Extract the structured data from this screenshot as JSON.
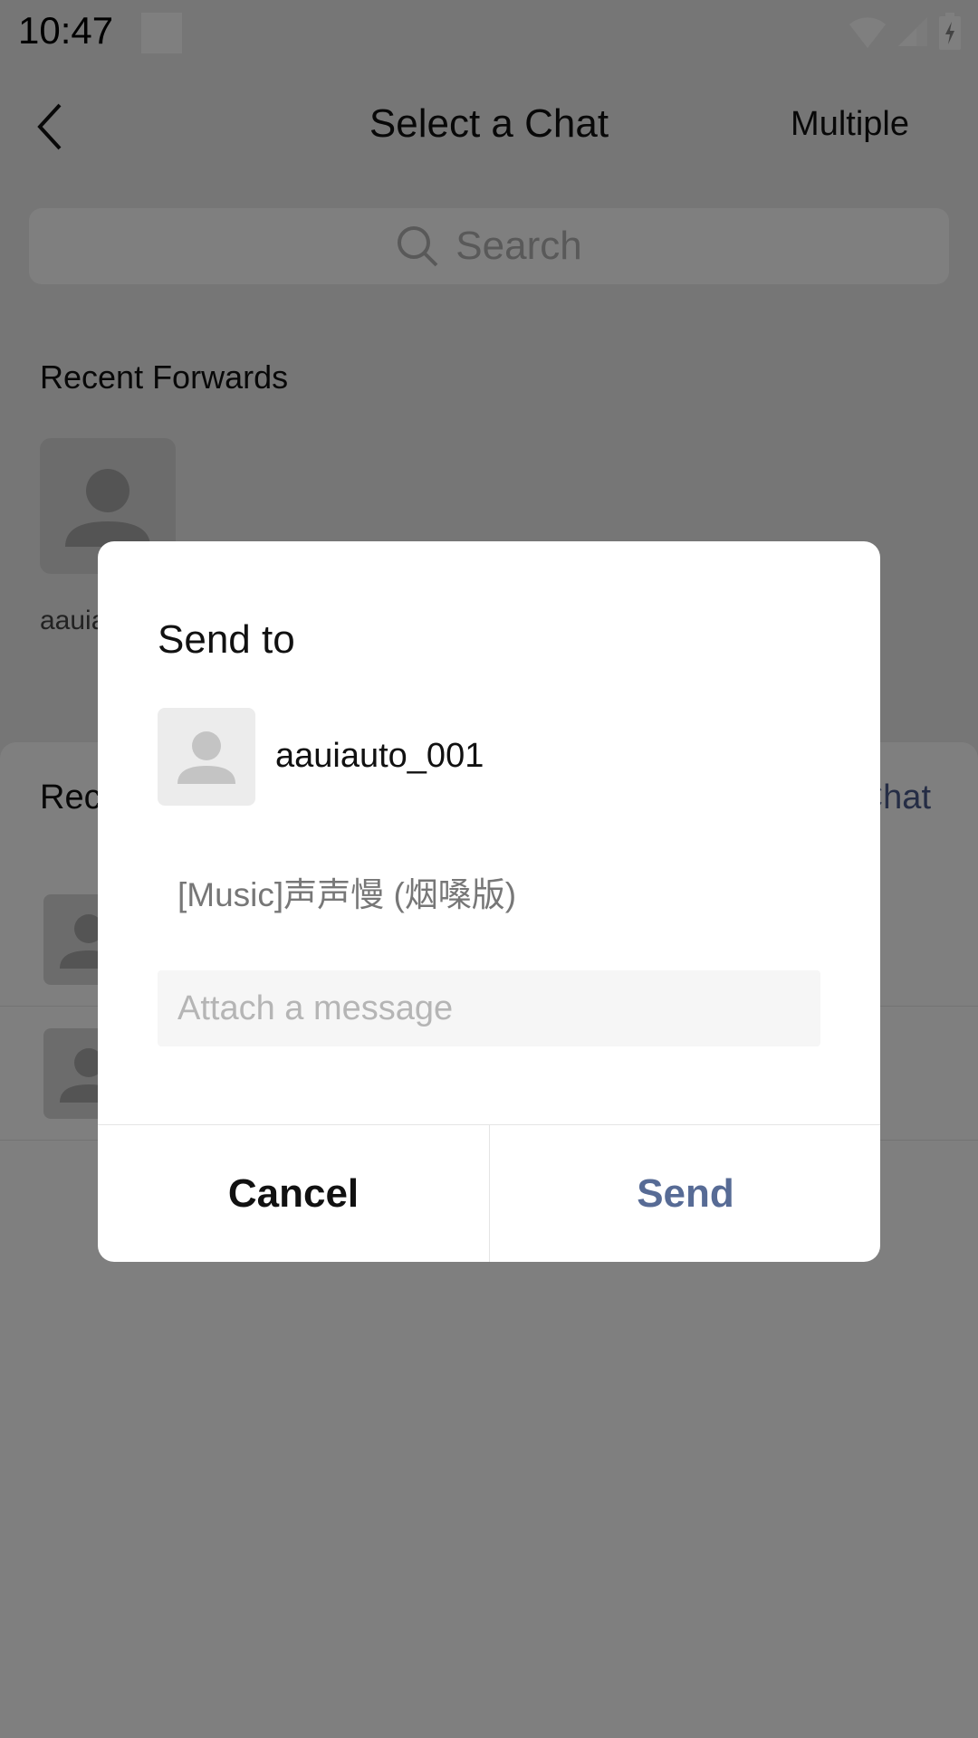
{
  "status_bar": {
    "time": "10:47"
  },
  "header": {
    "title": "Select a Chat",
    "multiple_label": "Multiple"
  },
  "search": {
    "placeholder": "Search"
  },
  "recent_forwards": {
    "title": "Recent Forwards",
    "items": [
      {
        "name": "aauiauto_001"
      }
    ]
  },
  "recent_chats": {
    "title": "Recent Chats",
    "new_chat_label": "New Chat"
  },
  "dialog": {
    "title": "Send to",
    "recipient_name": "aauiauto_001",
    "shared_item": "[Music]声声慢 (烟嗓版)",
    "message_placeholder": "Attach a message",
    "cancel_label": "Cancel",
    "send_label": "Send"
  },
  "colors": {
    "accent": "#576b95",
    "overlay": "rgba(0,0,0,0.5)"
  },
  "icons": [
    "back-arrow-icon",
    "search-icon",
    "default-avatar-icon",
    "wifi-icon",
    "cell-signal-icon",
    "battery-icon"
  ]
}
